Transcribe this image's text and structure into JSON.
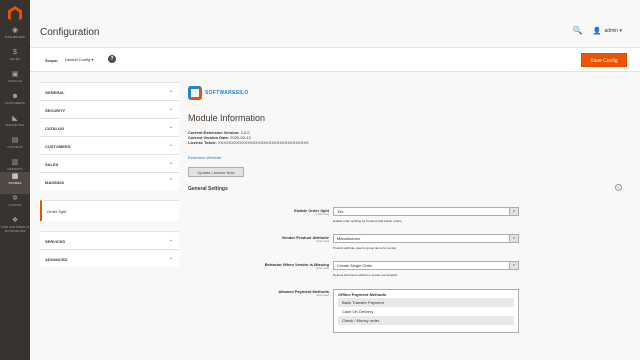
{
  "sidebar": {
    "items": [
      {
        "label": "DASHBOARD",
        "icon": "dashboard-icon",
        "glyph": "◉"
      },
      {
        "label": "SALES",
        "icon": "dollar-icon",
        "glyph": "$"
      },
      {
        "label": "CATALOG",
        "icon": "cube-icon",
        "glyph": "▣"
      },
      {
        "label": "CUSTOMERS",
        "icon": "person-icon",
        "glyph": "☻"
      },
      {
        "label": "MARKETING",
        "icon": "megaphone-icon",
        "glyph": "◣"
      },
      {
        "label": "CONTENT",
        "icon": "content-icon",
        "glyph": "▤"
      },
      {
        "label": "REPORTS",
        "icon": "bar-chart-icon",
        "glyph": "▥"
      },
      {
        "label": "STORES",
        "icon": "store-icon",
        "glyph": "▦"
      },
      {
        "label": "SYSTEM",
        "icon": "gear-icon",
        "glyph": "✲"
      },
      {
        "label": "FIND PARTNERS & EXTENSIONS",
        "icon": "extensions-icon",
        "glyph": "❖"
      }
    ]
  },
  "header": {
    "title": "Configuration",
    "search_glyph": "🔍",
    "user_glyph": "👤",
    "user_name": "admin ▾"
  },
  "scope": {
    "label": "Scope:",
    "value": "Default Config ▾",
    "help": "?"
  },
  "save_button": "Save Config",
  "tabs": [
    {
      "label": "GENERAL",
      "chevron": "⌄"
    },
    {
      "label": "SECURITY",
      "chevron": "⌄"
    },
    {
      "label": "CATALOG",
      "chevron": "⌄"
    },
    {
      "label": "CUSTOMERS",
      "chevron": "⌄"
    },
    {
      "label": "SALES",
      "chevron": "⌄"
    },
    {
      "label": "MAGE828",
      "chevron": "⌃"
    },
    {
      "label": "Order Split",
      "chevron": ""
    },
    {
      "label": "SERVICES",
      "chevron": "⌄"
    },
    {
      "label": "ADVANCED",
      "chevron": "⌄"
    }
  ],
  "module": {
    "brand": "SOFTWARESILO",
    "title": "Module Information",
    "version_label": "Current Extension Version:",
    "version_value": "1.0.0",
    "date_label": "Current Version Date:",
    "date_value": "2020-02-13",
    "license_label": "License Token:",
    "license_value": "XXXXXXXXXXXXXXXXXXXXXXXXXXXXXXXXXX",
    "link": "Extension Website",
    "update_button": "Update License Now"
  },
  "general_settings": {
    "title": "General Settings",
    "collapse": "⊙",
    "rows": [
      {
        "label": "Enable Order Split",
        "scope": "[store view]",
        "value": "Yes",
        "note": "Enable order splitting for frontend and admin orders."
      },
      {
        "label": "Vendor Product Attribute",
        "scope": "[store view]",
        "value": "Manufacturer",
        "note": "Product attribute used to group items by vendor."
      },
      {
        "label": "Behavior When Vendor is Missing",
        "scope": "[store view]",
        "value": "Create Single Order",
        "note": "Defines how items without a vendor are handled."
      },
      {
        "label": "Allowed Payment Methods",
        "scope": "[store view]"
      }
    ],
    "payment_group": "Offline Payment Methods",
    "payment_options": [
      "Bank Transfer Payment",
      "Cash On Delivery",
      "Check / Money order"
    ]
  }
}
